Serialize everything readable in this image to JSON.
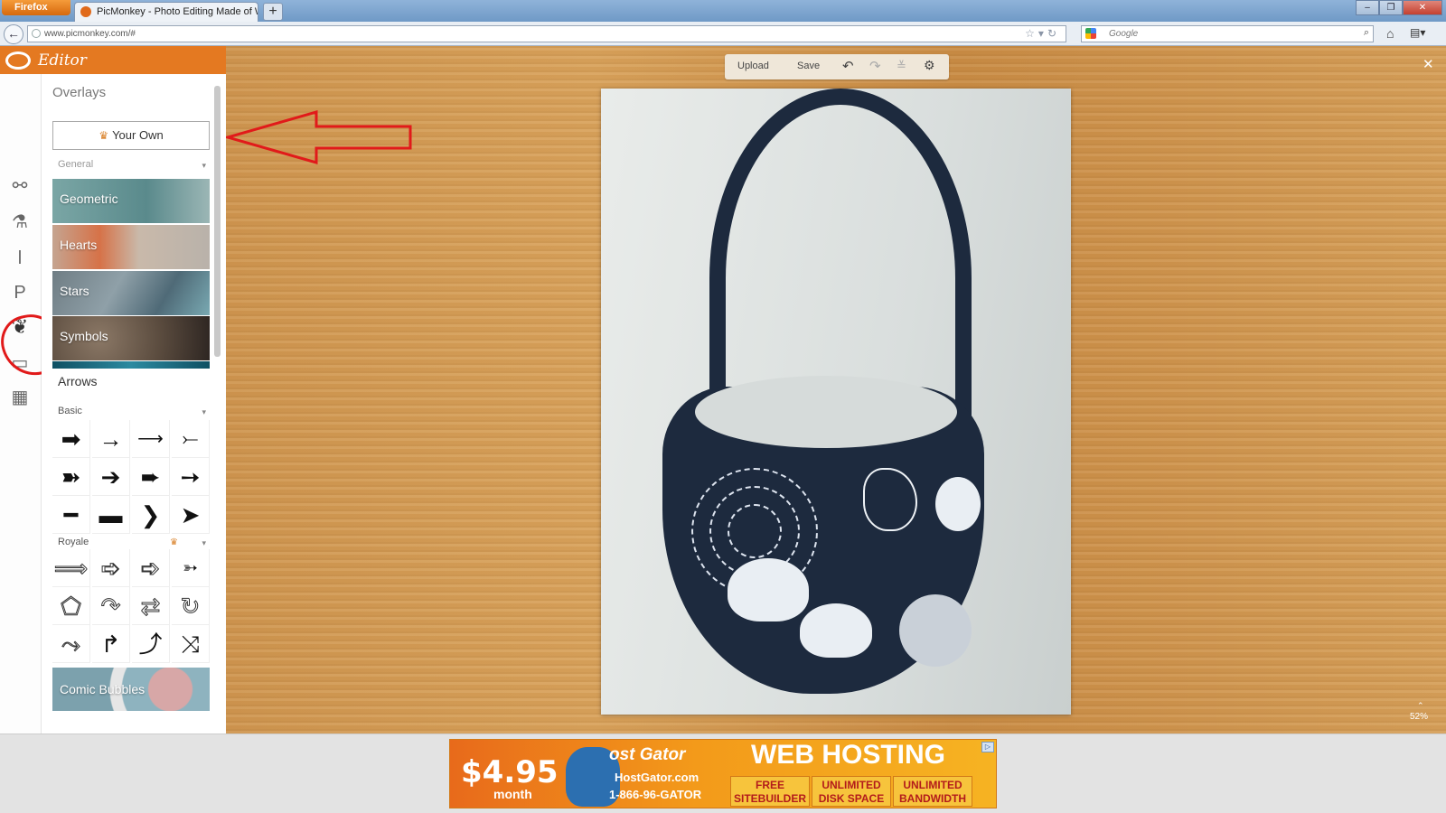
{
  "browser": {
    "menu_button": "Firefox",
    "tab_title": "PicMonkey - Photo Editing Made of Win",
    "new_tab": "+",
    "url": "www.picmonkey.com/#",
    "search_placeholder": "Google"
  },
  "app": {
    "title": "Editor"
  },
  "panel": {
    "title": "Overlays",
    "your_own_label": "Your Own",
    "general_label": "General",
    "categories": [
      {
        "label": "Geometric"
      },
      {
        "label": "Hearts"
      },
      {
        "label": "Stars"
      },
      {
        "label": "Symbols"
      }
    ],
    "arrows_title": "Arrows",
    "basic_label": "Basic",
    "royale_label": "Royale",
    "comic_label": "Comic Bubbles"
  },
  "toolbar": {
    "upload_label": "Upload",
    "save_label": "Save"
  },
  "canvas": {
    "zoom": "52%"
  },
  "ad": {
    "price": "$4.95",
    "price_unit": "month",
    "brand": "ost Gator",
    "site": "HostGator.com",
    "phone": "1-866-96-GATOR",
    "headline": "WEB HOSTING",
    "features": [
      "FREE SITEBUILDER",
      "UNLIMITED DISK SPACE",
      "UNLIMITED BANDWIDTH"
    ]
  }
}
